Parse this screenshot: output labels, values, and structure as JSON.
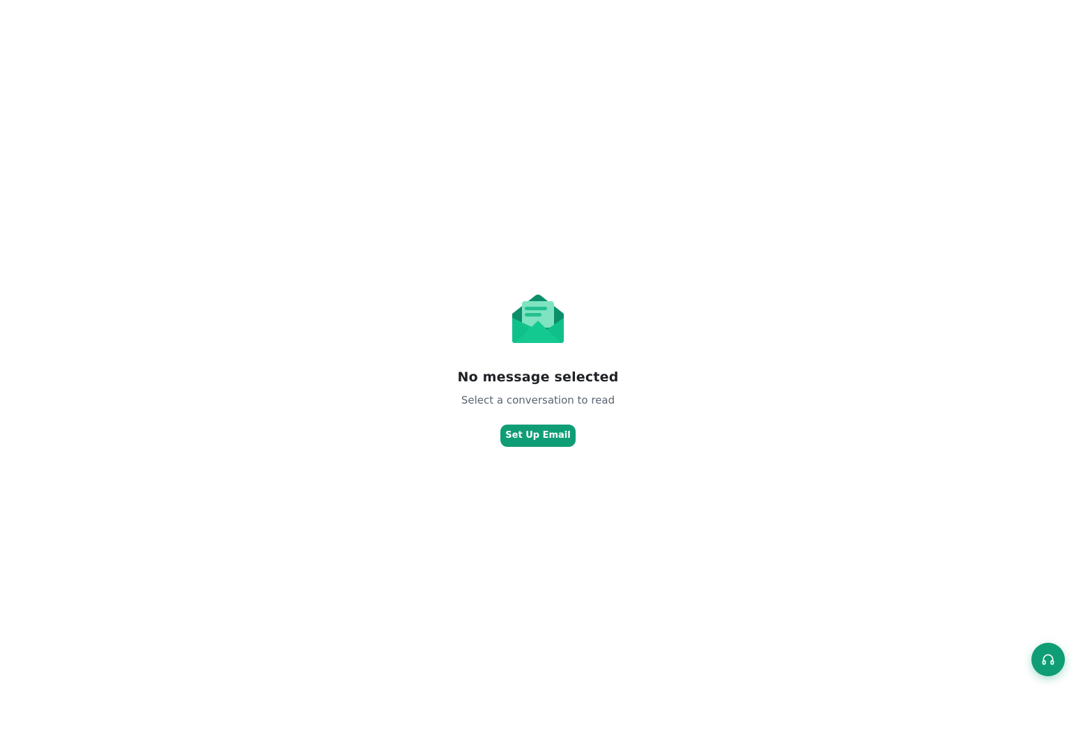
{
  "empty_state": {
    "icon": "open-envelope-icon",
    "title": "No message selected",
    "subtitle": "Select a conversation to read",
    "button_label": "Set Up Email"
  },
  "support": {
    "icon": "headphones-icon"
  },
  "colors": {
    "accent": "#0f9d76",
    "accent_light": "#5fdcb2",
    "title_text": "#1f2126",
    "subtitle_text": "#5b6472",
    "background": "#ffffff"
  }
}
